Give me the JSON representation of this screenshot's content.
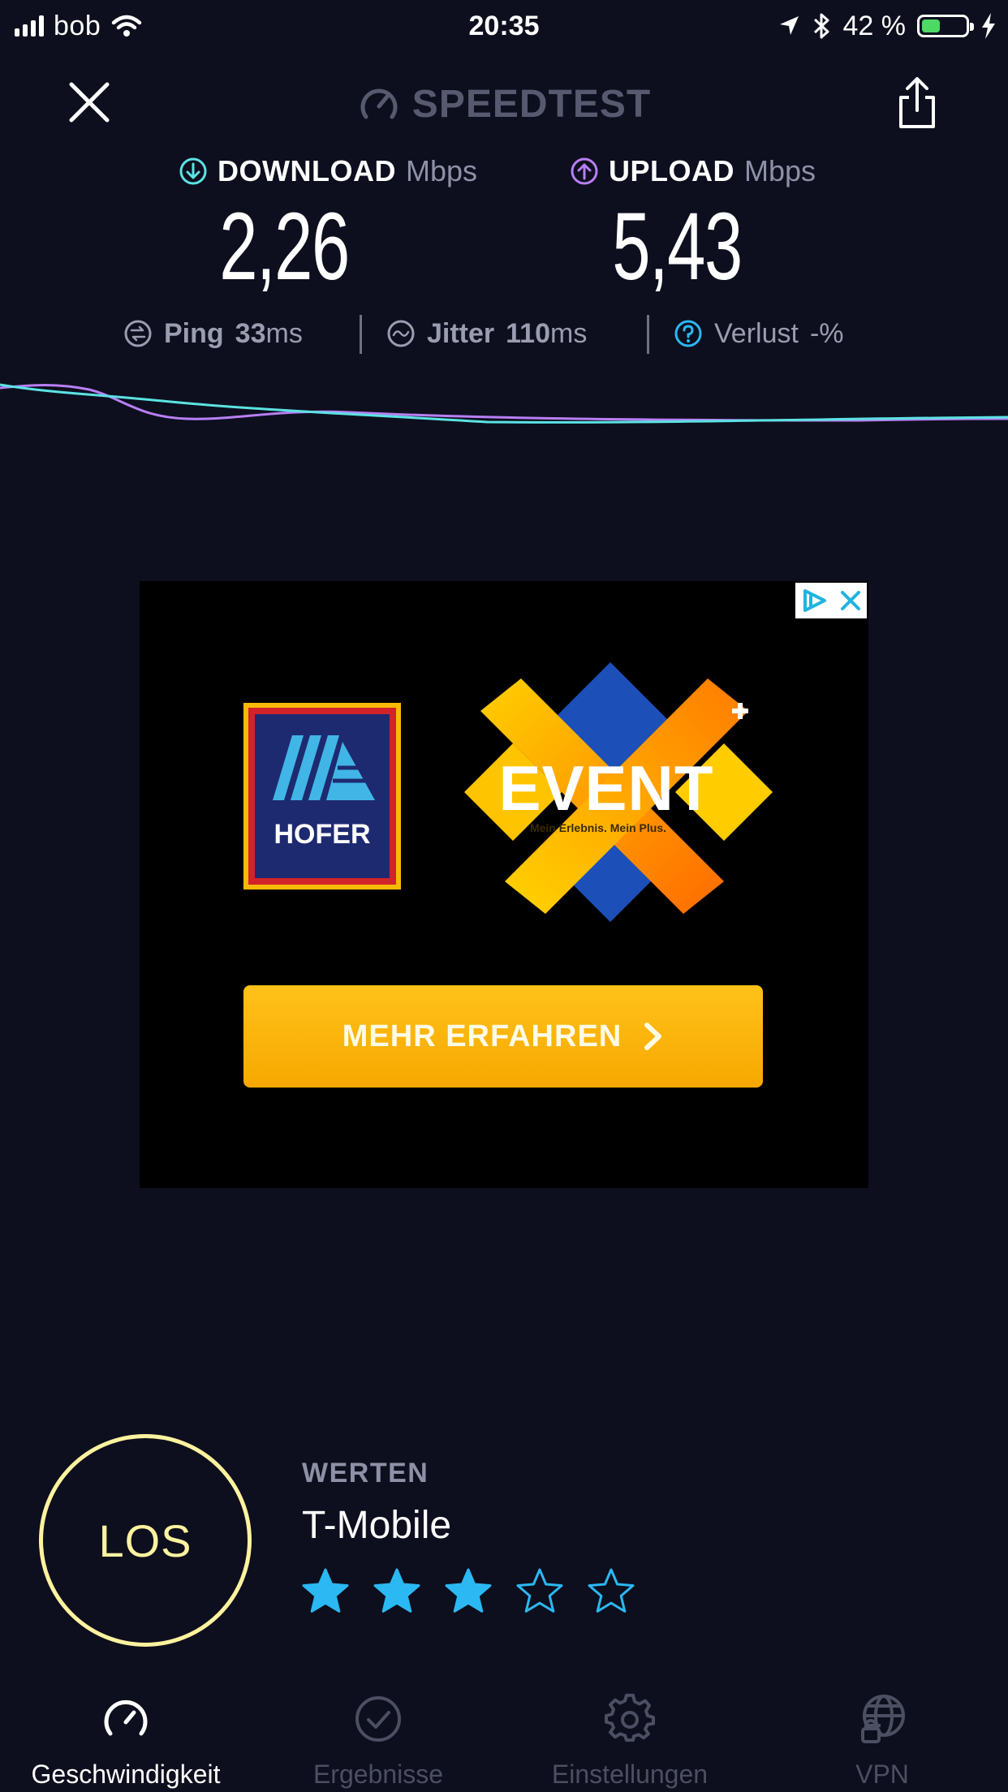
{
  "status_bar": {
    "carrier": "bob",
    "time": "20:35",
    "battery_percent": "42 %",
    "battery_level": 0.42,
    "battery_color": "#4cd964"
  },
  "header": {
    "title": "SPEEDTEST",
    "close_icon": "close-icon",
    "share_icon": "share-icon"
  },
  "download": {
    "label": "DOWNLOAD",
    "unit": "Mbps",
    "value": "2,26",
    "color": "#5be3e3"
  },
  "upload": {
    "label": "UPLOAD",
    "unit": "Mbps",
    "value": "5,43",
    "color": "#b87ff5"
  },
  "stats": {
    "ping": {
      "label": "Ping",
      "value": "33",
      "unit": "ms"
    },
    "jitter": {
      "label": "Jitter",
      "value": "110",
      "unit": "ms"
    },
    "loss": {
      "label": "Verlust",
      "value": "-",
      "unit": "%"
    }
  },
  "ad": {
    "brand": "HOFER",
    "event_title": "EVENT",
    "event_tagline": "Mein Erlebnis. Mein Plus.",
    "cta": "MEHR ERFAHREN"
  },
  "go_button": {
    "label": "LOS"
  },
  "rating": {
    "heading": "WERTEN",
    "provider": "T-Mobile",
    "stars_filled": 3,
    "stars_total": 5,
    "star_color": "#2bb8f3"
  },
  "tabs": [
    {
      "label": "Geschwindigkeit",
      "icon": "speedometer-icon",
      "active": true
    },
    {
      "label": "Ergebnisse",
      "icon": "check-circle-icon",
      "active": false
    },
    {
      "label": "Einstellungen",
      "icon": "gear-icon",
      "active": false
    },
    {
      "label": "VPN",
      "icon": "globe-lock-icon",
      "active": false
    }
  ]
}
